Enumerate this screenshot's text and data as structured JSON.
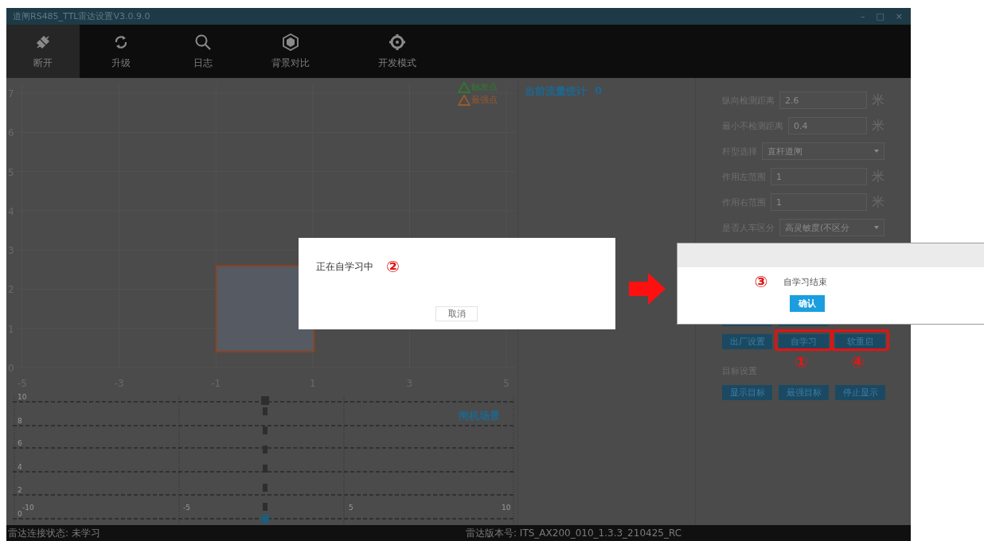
{
  "window": {
    "title": "道闸RS485_TTL雷达设置V3.0.9.0",
    "controls": [
      "–",
      "□",
      "×"
    ]
  },
  "toolbar": [
    {
      "label": "断开",
      "kind": "disconnect",
      "selected": true
    },
    {
      "label": "升级",
      "kind": "refresh",
      "selected": false
    },
    {
      "label": "日志",
      "kind": "search",
      "selected": false
    },
    {
      "label": "背景对比",
      "kind": "hexagon",
      "selected": false
    },
    {
      "label": "开发模式",
      "kind": "gear",
      "selected": false
    }
  ],
  "plot": {
    "y_ticks": [
      "7",
      "6",
      "5",
      "4",
      "3",
      "2",
      "1",
      "0"
    ],
    "x_ticks": [
      "-5",
      "-3",
      "-1",
      "1",
      "3",
      "5"
    ],
    "legend": [
      {
        "label": "触发点",
        "color": "#2f7a2f"
      },
      {
        "label": "最强点",
        "color": "#9a5a2c"
      }
    ]
  },
  "stats": {
    "label": "当前流量统计",
    "value": "0"
  },
  "settings": {
    "rows": [
      {
        "kind": "input",
        "label": "纵向检测距离",
        "value": "2.6",
        "unit": "米"
      },
      {
        "kind": "input",
        "label": "最小不检测距离",
        "value": "0.4",
        "unit": "米"
      },
      {
        "kind": "select",
        "label": "杆型选择",
        "value": "直杆道闸"
      },
      {
        "kind": "input",
        "label": "作用左范围",
        "value": "1",
        "unit": "米"
      },
      {
        "kind": "input",
        "label": "作用右范围",
        "value": "1",
        "unit": "米"
      },
      {
        "kind": "select",
        "label": "是否人车区分",
        "value": "高灵敏度(不区分"
      }
    ],
    "action_buttons": [
      {
        "label": "出厂设置",
        "highlighted": false
      },
      {
        "label": "自学习",
        "highlighted": true,
        "annotation": "①"
      },
      {
        "label": "软重启",
        "highlighted": true,
        "annotation": "④"
      }
    ],
    "target_label": "目标设置",
    "target_buttons": [
      "显示目标",
      "最强目标",
      "停止显示"
    ]
  },
  "scene": {
    "title": "闸机场景",
    "y_ticks": [
      "10",
      "8",
      "6",
      "4",
      "2",
      "0"
    ],
    "x_ticks": [
      "-10",
      "-5",
      "5",
      "10"
    ]
  },
  "status_bar": {
    "connection": "雷达连接状态: 未学习",
    "version": "雷达版本号: ITS_AX200_010_1.3.3_210425_RC"
  },
  "learning_dialog": {
    "message": "正在自学习中",
    "annotation": "②",
    "button": "取消"
  },
  "done_dialog": {
    "annotation": "③",
    "message": "自学习结束",
    "button": "确认"
  }
}
